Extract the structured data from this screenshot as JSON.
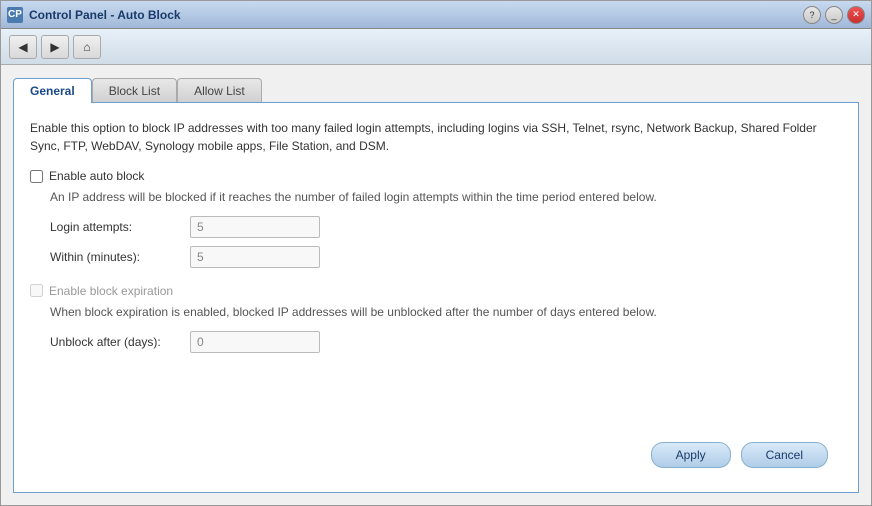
{
  "window": {
    "title": "Control Panel - Auto Block",
    "icon_label": "CP"
  },
  "toolbar": {
    "back_label": "◀",
    "forward_label": "▶",
    "home_label": "⌂"
  },
  "tabs": [
    {
      "id": "general",
      "label": "General",
      "active": true
    },
    {
      "id": "block-list",
      "label": "Block List",
      "active": false
    },
    {
      "id": "allow-list",
      "label": "Allow List",
      "active": false
    }
  ],
  "general": {
    "description": "Enable this option to block IP addresses with too many failed login attempts, including logins via SSH, Telnet, rsync, Network Backup, Shared Folder Sync, FTP, WebDAV, Synology mobile apps, File Station, and DSM.",
    "enable_auto_block_label": "Enable auto block",
    "enable_auto_block_checked": false,
    "sub_text": "An IP address will be blocked if it reaches the number of failed login attempts within the time period entered below.",
    "login_attempts_label": "Login attempts:",
    "login_attempts_value": "5",
    "within_minutes_label": "Within (minutes):",
    "within_minutes_value": "5",
    "enable_block_expiration_label": "Enable block expiration",
    "enable_block_expiration_checked": false,
    "block_expiry_sub_text": "When block expiration is enabled, blocked IP addresses will be unblocked after the number of days entered below.",
    "unblock_after_label": "Unblock after (days):",
    "unblock_after_value": "0"
  },
  "footer": {
    "apply_label": "Apply",
    "cancel_label": "Cancel"
  }
}
